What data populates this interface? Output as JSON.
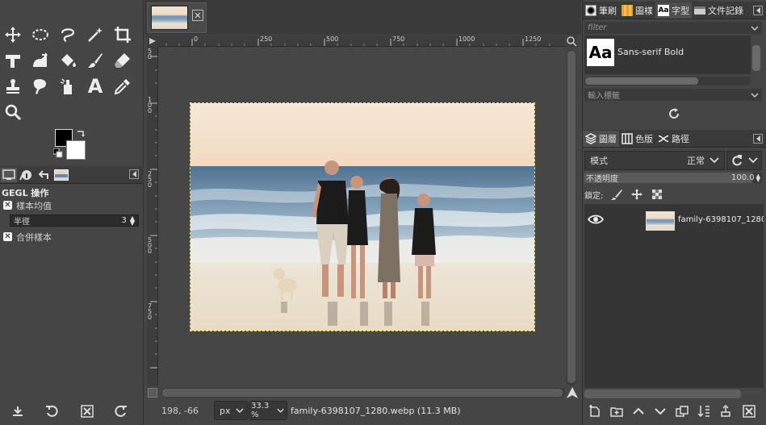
{
  "toolbox": {
    "tools": [
      "move-tool",
      "ellipse-select-tool",
      "free-select-tool",
      "fuzzy-select-tool",
      "crop-tool",
      "unified-transform-tool",
      "warp-transform-tool",
      "bucket-fill-tool",
      "paintbrush-tool",
      "eraser-tool",
      "clone-tool",
      "smudge-tool",
      "dodge-burn-tool",
      "text-tool",
      "color-picker-tool",
      "zoom-tool"
    ],
    "text_tool_glyph": "A",
    "fg_color": "#000000",
    "bg_color": "#ffffff"
  },
  "tool_options": {
    "title": "GEGL 操作",
    "sample_average_label": "樣本均值",
    "radius_label": "半徑",
    "radius_value": "3",
    "sample_merged_label": "合併樣本"
  },
  "image_window": {
    "ruler_top_labels": [
      "0",
      "250",
      "500",
      "750",
      "1000",
      "1250"
    ],
    "ruler_left_labels": [
      "5 0",
      "1 0 0",
      "2 5 0",
      "5 0 0",
      "7 5 0"
    ],
    "coords": "198, -66",
    "unit": "px",
    "zoom": "33.3 %",
    "status": "family-6398107_1280.webp (11.3 MB)"
  },
  "right_dock": {
    "top_tabs": [
      {
        "label": "筆刷",
        "icon": "brush-icon"
      },
      {
        "label": "圖樣",
        "icon": "pattern-icon"
      },
      {
        "label": "字型",
        "icon": "font-icon"
      },
      {
        "label": "文件記錄",
        "icon": "document-history-icon"
      }
    ],
    "font_tab_glyph": "Aa",
    "filter_placeholder": "filter",
    "font_preview": "Aa",
    "font_name": "Sans-serif Bold",
    "tag_placeholder": "輸入標籤",
    "layer_tabs": [
      {
        "label": "圖層",
        "icon": "layers-icon"
      },
      {
        "label": "色版",
        "icon": "channels-icon"
      },
      {
        "label": "路徑",
        "icon": "paths-icon"
      }
    ],
    "mode_label": "模式",
    "mode_value": "正常",
    "opacity_label": "不透明度",
    "opacity_value": "100.0",
    "opacity_fraction": 1.0,
    "lock_label": "鎖定:",
    "layer_name": "family-6398107_1280.webp"
  },
  "colors": {
    "selection_outline": "#e8e24a",
    "panel_bg": "#454545"
  }
}
